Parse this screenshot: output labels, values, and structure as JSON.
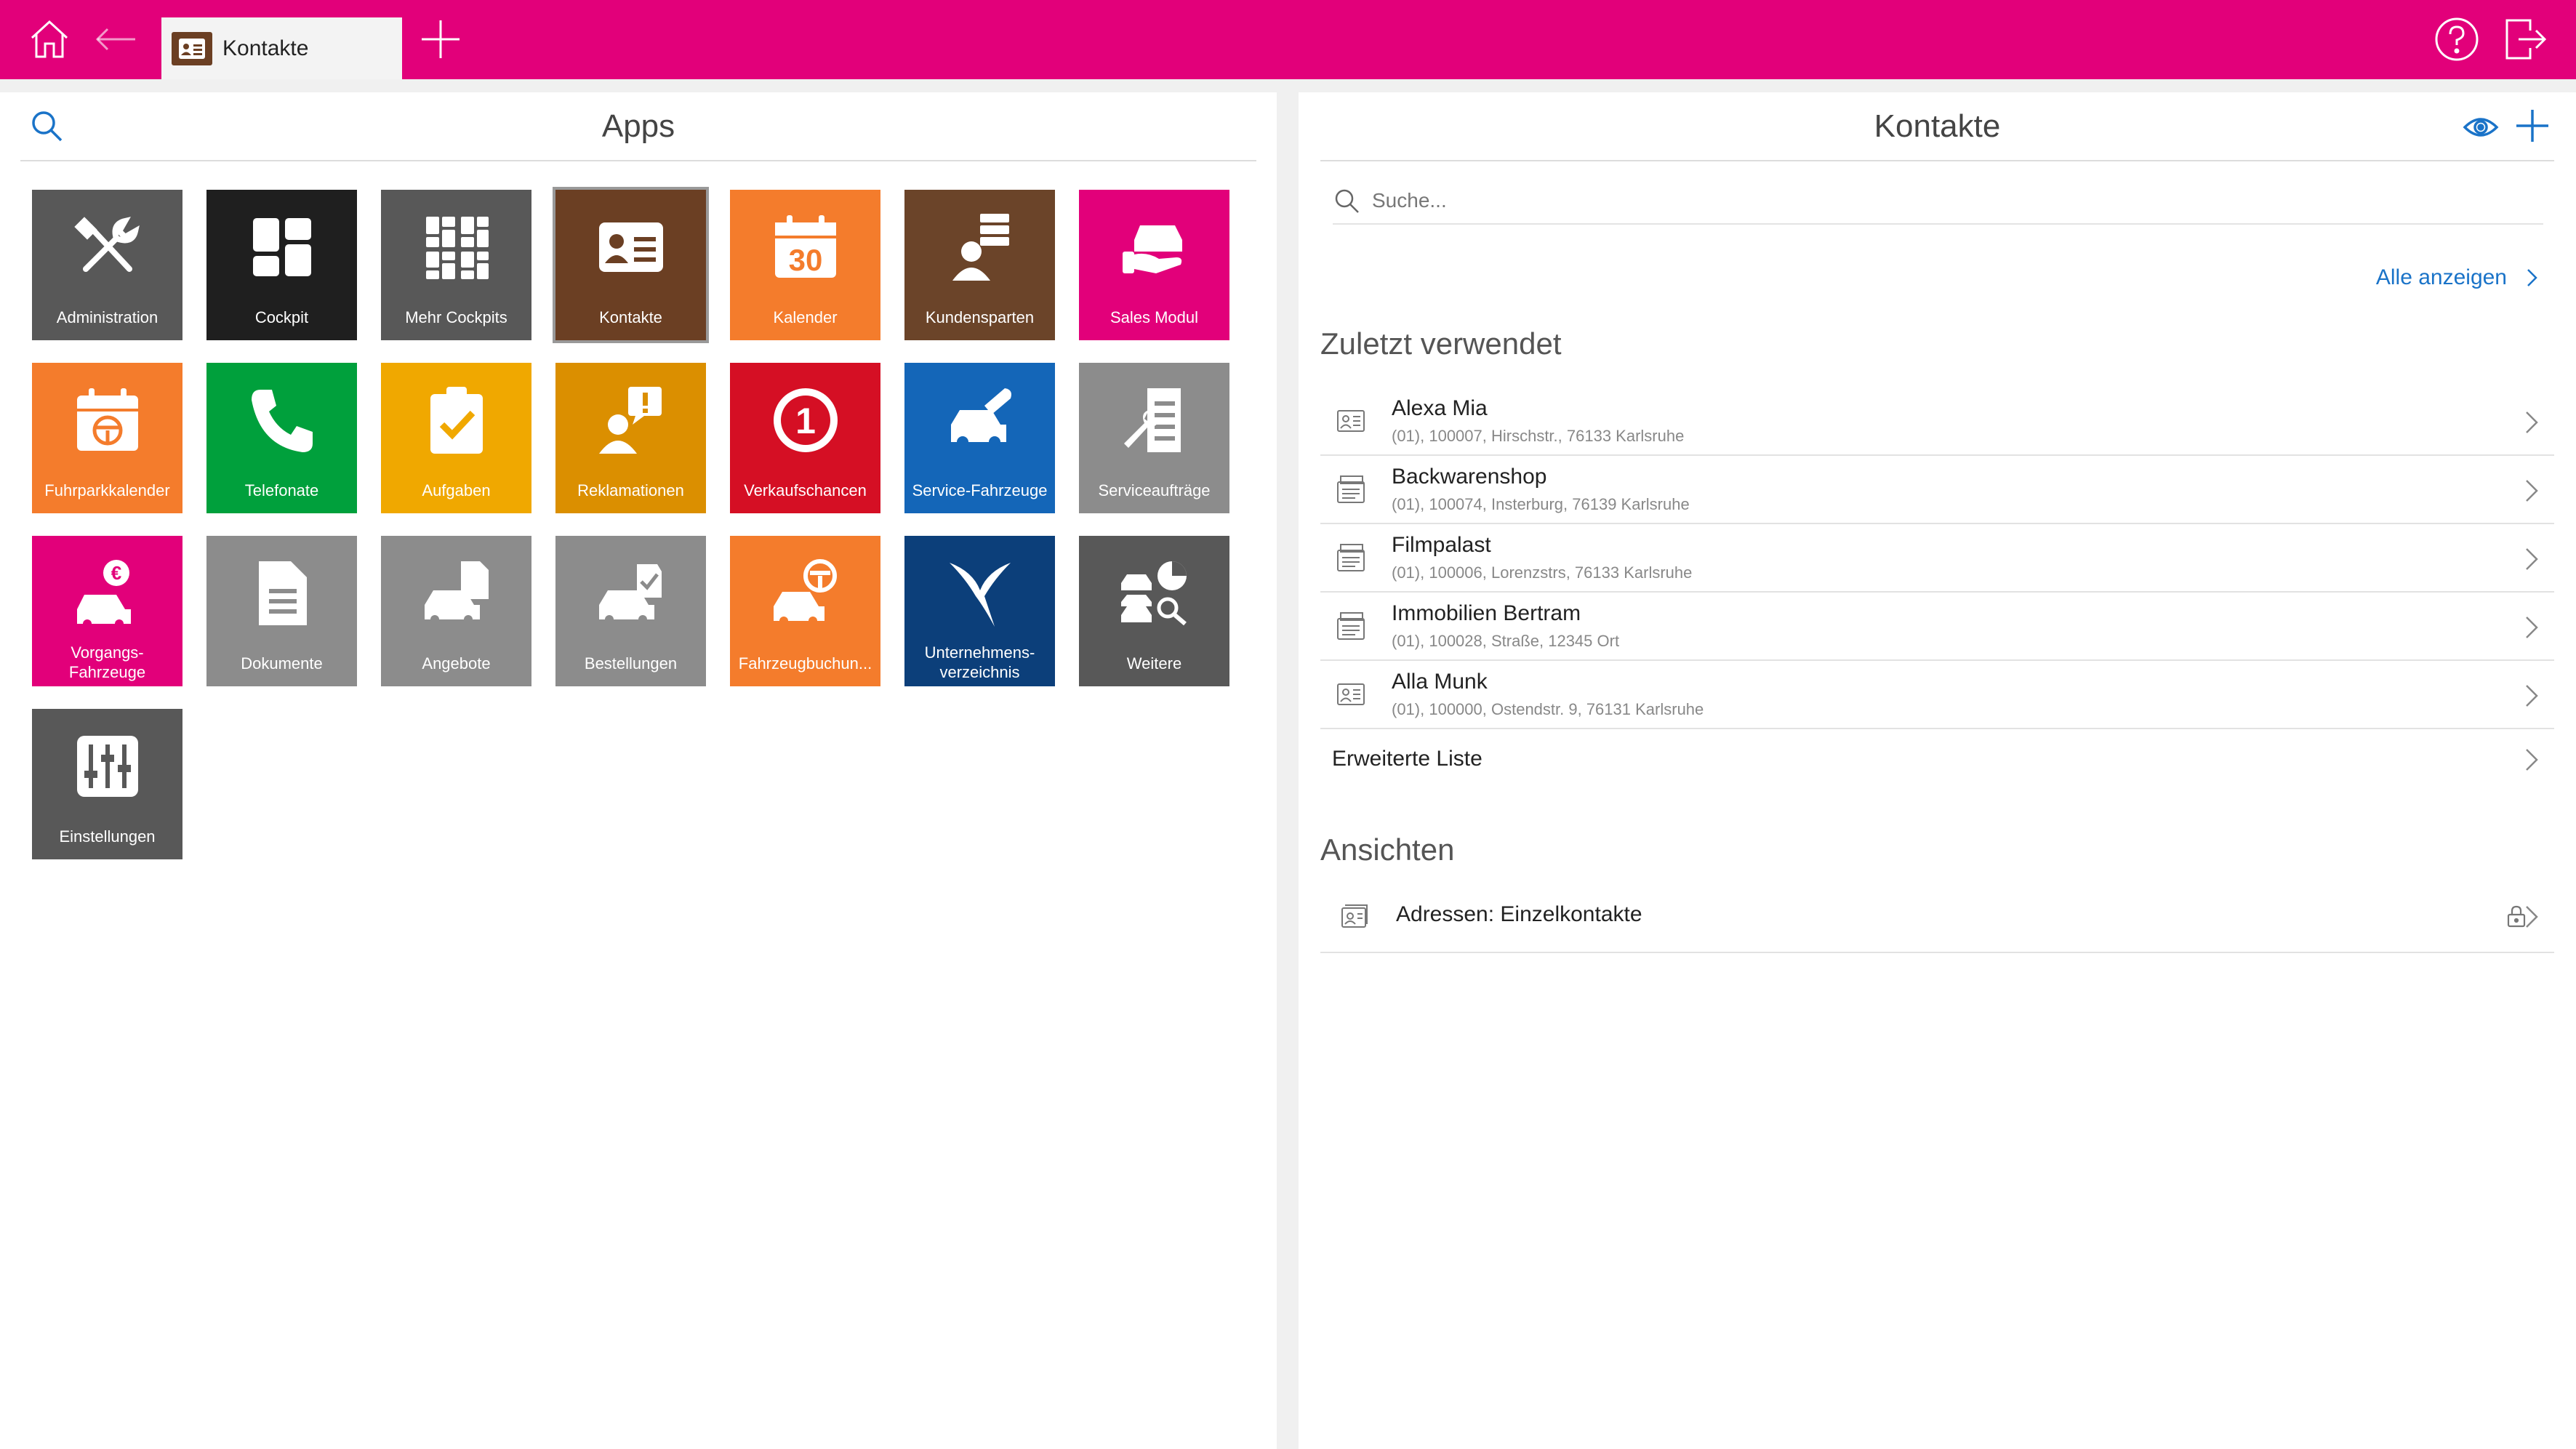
{
  "colors": {
    "topbar": "#e2007a",
    "link": "#1a73c8",
    "tab_glyph": "#6b3f23"
  },
  "topbar": {
    "icons": [
      "home-icon",
      "back-arrow-icon",
      "plus-icon",
      "help-icon",
      "logout-icon"
    ],
    "tab_label": "Kontakte"
  },
  "apps_panel": {
    "title": "Apps",
    "tiles": [
      {
        "label": "Administration",
        "color": "#585858",
        "icon": "tools-icon"
      },
      {
        "label": "Cockpit",
        "color": "#1f1f1f",
        "icon": "cockpit-icon"
      },
      {
        "label": "Mehr Cockpits",
        "color": "#585858",
        "icon": "more-cockpits-icon"
      },
      {
        "label": "Kontakte",
        "color": "#6b3f23",
        "icon": "contact-card-icon"
      },
      {
        "label": "Kalender",
        "color": "#f47c2c",
        "icon": "calendar-30-icon",
        "calendar_day": "30"
      },
      {
        "label": "Kundensparten",
        "color": "#6b4429",
        "icon": "customer-segments-icon"
      },
      {
        "label": "Sales Modul",
        "color": "#e2007a",
        "icon": "sales-car-icon"
      },
      {
        "label": "Fuhrparkkalender",
        "color": "#f47c2c",
        "icon": "fleet-calendar-icon"
      },
      {
        "label": "Telefonate",
        "color": "#00a03c",
        "icon": "phone-icon"
      },
      {
        "label": "Aufgaben",
        "color": "#f0a800",
        "icon": "task-clipboard-icon"
      },
      {
        "label": "Reklamationen",
        "color": "#db8f00",
        "icon": "complaint-icon"
      },
      {
        "label": "Verkaufschancen",
        "color": "#d50f24",
        "icon": "sales-opportunity-icon",
        "badge": "1"
      },
      {
        "label": "Service-Fahrzeuge",
        "color": "#1466b8",
        "icon": "service-car-icon"
      },
      {
        "label": "Serviceaufträge",
        "color": "#8c8c8c",
        "icon": "service-order-icon"
      },
      {
        "label": "Vorgangs-Fahrzeuge",
        "color": "#e2007a",
        "icon": "euro-car-icon",
        "two_line": true
      },
      {
        "label": "Dokumente",
        "color": "#8c8c8c",
        "icon": "document-icon"
      },
      {
        "label": "Angebote",
        "color": "#8c8c8c",
        "icon": "offer-car-icon"
      },
      {
        "label": "Bestellungen",
        "color": "#8c8c8c",
        "icon": "order-car-icon"
      },
      {
        "label": "Fahrzeugbuchun...",
        "color": "#f47c2c",
        "icon": "car-booking-icon"
      },
      {
        "label": "Unternehmens-verzeichnis",
        "color": "#0c3f7a",
        "icon": "company-directory-icon",
        "two_line": true
      },
      {
        "label": "Weitere",
        "color": "#585858",
        "icon": "more-apps-icon"
      },
      {
        "label": "Einstellungen",
        "color": "#585858",
        "icon": "settings-sliders-icon"
      }
    ]
  },
  "contacts_panel": {
    "title": "Kontakte",
    "search_placeholder": "Suche...",
    "show_all": "Alle anzeigen",
    "recent_heading": "Zuletzt verwendet",
    "recent": [
      {
        "name": "Alexa Mia",
        "detail": "(01), 100007, Hirschstr., 76133 Karlsruhe",
        "icon": "person-card-icon"
      },
      {
        "name": "Backwarenshop",
        "detail": "(01), 100074, Insterburg, 76139 Karlsruhe",
        "icon": "company-card-icon"
      },
      {
        "name": "Filmpalast",
        "detail": "(01), 100006, Lorenzstrs, 76133 Karlsruhe",
        "icon": "company-card-icon"
      },
      {
        "name": "Immobilien Bertram",
        "detail": "(01), 100028, Straße, 12345 Ort",
        "icon": "company-card-icon"
      },
      {
        "name": "Alla Munk",
        "detail": "(01), 100000, Ostendstr. 9, 76131 Karlsruhe",
        "icon": "person-card-icon"
      }
    ],
    "extended_list": "Erweiterte Liste",
    "views_heading": "Ansichten",
    "views": [
      {
        "label": "Adressen: Einzelkontakte",
        "locked": true
      }
    ]
  }
}
